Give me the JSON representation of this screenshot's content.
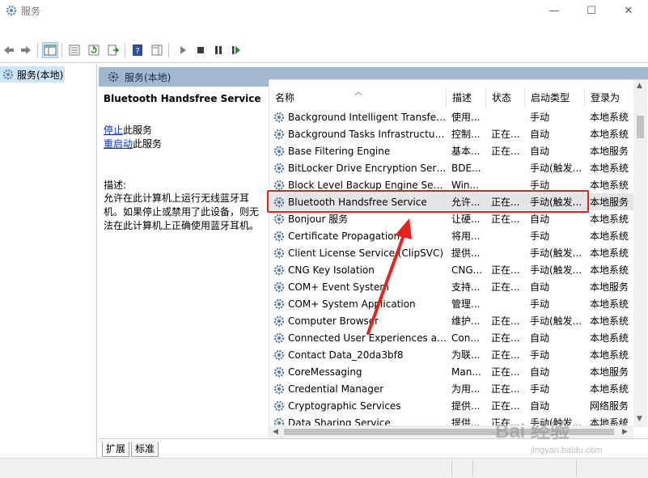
{
  "window": {
    "title": "服务",
    "minimize": "—",
    "maximize": "☐",
    "close": "✕"
  },
  "tree": {
    "item_label": "服务(本地)"
  },
  "pane": {
    "header": "服务(本地)"
  },
  "details": {
    "service_title": "Bluetooth Handsfree Service",
    "stop_link": "停止",
    "stop_suffix": "此服务",
    "restart_link": "重启动",
    "restart_suffix": "此服务",
    "desc_label": "描述:",
    "desc_text": "允许在此计算机上运行无线蓝牙耳机。如果停止或禁用了此设备，则无法在此计算机上正确使用蓝牙耳机。"
  },
  "columns": {
    "name": "名称",
    "desc": "描述",
    "state": "状态",
    "startup": "启动类型",
    "logon": "登录为"
  },
  "rows": [
    {
      "name": "Background Intelligent Transfer...",
      "desc": "使用...",
      "state": "",
      "startup": "手动",
      "logon": "本地系统"
    },
    {
      "name": "Background Tasks Infrastructur...",
      "desc": "控制...",
      "state": "正在...",
      "startup": "自动",
      "logon": "本地系统"
    },
    {
      "name": "Base Filtering Engine",
      "desc": "基本...",
      "state": "正在...",
      "startup": "自动",
      "logon": "本地服务"
    },
    {
      "name": "BitLocker Drive Encryption Servi...",
      "desc": "BDE...",
      "state": "",
      "startup": "手动(触发...",
      "logon": "本地系统"
    },
    {
      "name": "Block Level Backup Engine Serv...",
      "desc": "Win...",
      "state": "",
      "startup": "手动",
      "logon": "本地系统"
    },
    {
      "name": "Bluetooth Handsfree Service",
      "desc": "允许...",
      "state": "正在...",
      "startup": "手动(触发...",
      "logon": "本地服务"
    },
    {
      "name": "Bonjour 服务",
      "desc": "让硬...",
      "state": "正在...",
      "startup": "自动",
      "logon": "本地系统"
    },
    {
      "name": "Certificate Propagation",
      "desc": "将用...",
      "state": "",
      "startup": "手动",
      "logon": "本地系统"
    },
    {
      "name": "Client License Service (ClipSVC)",
      "desc": "提供...",
      "state": "",
      "startup": "手动(触发...",
      "logon": "本地系统"
    },
    {
      "name": "CNG Key Isolation",
      "desc": "CNG...",
      "state": "正在...",
      "startup": "手动(触发...",
      "logon": "本地系统"
    },
    {
      "name": "COM+ Event System",
      "desc": "支持...",
      "state": "正在...",
      "startup": "自动",
      "logon": "本地服务"
    },
    {
      "name": "COM+ System Application",
      "desc": "管理...",
      "state": "",
      "startup": "手动",
      "logon": "本地系统"
    },
    {
      "name": "Computer Browser",
      "desc": "维护...",
      "state": "正在...",
      "startup": "手动(触发...",
      "logon": "本地系统"
    },
    {
      "name": "Connected User Experiences an...",
      "desc": "Con...",
      "state": "正在...",
      "startup": "自动",
      "logon": "本地系统"
    },
    {
      "name": "Contact Data_20da3bf8",
      "desc": "为联...",
      "state": "正在...",
      "startup": "手动",
      "logon": "本地系统"
    },
    {
      "name": "CoreMessaging",
      "desc": "Man...",
      "state": "正在...",
      "startup": "自动",
      "logon": "本地服务"
    },
    {
      "name": "Credential Manager",
      "desc": "为用...",
      "state": "正在...",
      "startup": "手动",
      "logon": "本地系统"
    },
    {
      "name": "Cryptographic Services",
      "desc": "提供...",
      "state": "正在...",
      "startup": "自动",
      "logon": "网络服务"
    },
    {
      "name": "Data Sharing Service",
      "desc": "提供...",
      "state": "正在...",
      "startup": "手动(触发...",
      "logon": "本地系统"
    }
  ],
  "selected_row": 5,
  "tabs": {
    "extended": "扩展",
    "standard": "标准"
  },
  "watermark": {
    "main": "Bai  经验",
    "sub": "jingyan.baidu.com"
  },
  "colors": {
    "highlight": "#e8231f",
    "pane_header": "#a2b8ce",
    "link": "#0033cc"
  }
}
